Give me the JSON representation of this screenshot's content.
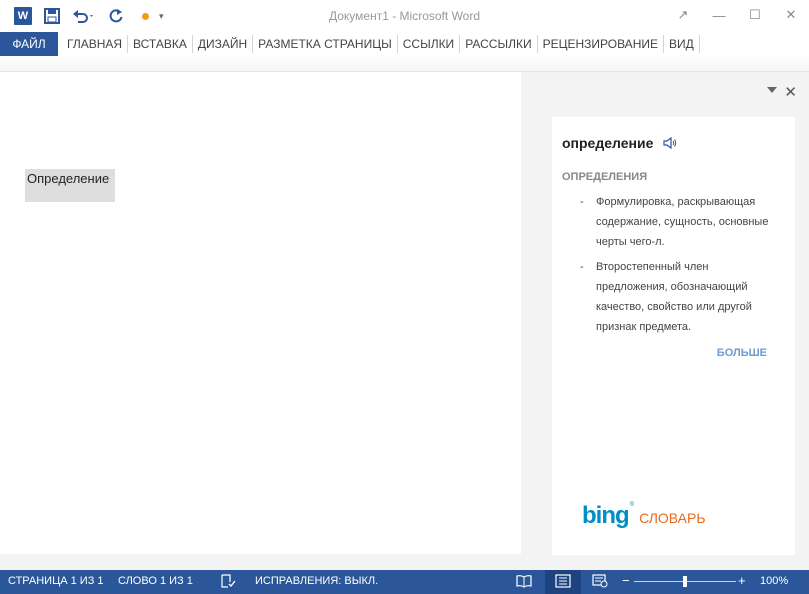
{
  "titlebar": {
    "app_icon_letter": "W",
    "title": "Документ1 - Microsoft Word",
    "qat_more": "▾",
    "controls": [
      "↗",
      "—",
      "☐",
      "✕"
    ]
  },
  "ribbon": {
    "file_tab": "ФАЙЛ",
    "tabs": [
      "ГЛАВНАЯ",
      "ВСТАВКА",
      "ДИЗАЙН",
      "РАЗМЕТКА СТРАНИЦЫ",
      "ССЫЛКИ",
      "РАССЫЛКИ",
      "РЕЦЕНЗИРОВАНИЕ",
      "ВИД"
    ]
  },
  "document": {
    "selected_text": "Определение"
  },
  "pane": {
    "close": "✕",
    "term": "определение",
    "section_title": "ОПРЕДЕЛЕНИЯ",
    "bullet": "-",
    "definitions": [
      "Формулировка, раскрывающая содержание, сущность, основные черты чего-л.",
      "Второстепенный член предложения, обозначающий качество, свойство или другой признак предмета."
    ],
    "more_link": "БОЛЬШЕ",
    "bing_logo": "bing",
    "bing_tm": "®",
    "bing_dictionary": "СЛОВАРЬ"
  },
  "statusbar": {
    "page": "СТРАНИЦА 1 ИЗ 1",
    "words": "СЛОВО 1 ИЗ 1",
    "track_changes": "ИСПРАВЛЕНИЯ: ВЫКЛ.",
    "zoom_minus": "−",
    "zoom_plus": "+",
    "zoom_level": "100%",
    "zoom_fraction": 0.5
  },
  "colors": {
    "accent": "#2b579a",
    "bing": "#008fc5",
    "dictionary": "#e66b1d",
    "more_link": "#6b9bd1"
  }
}
